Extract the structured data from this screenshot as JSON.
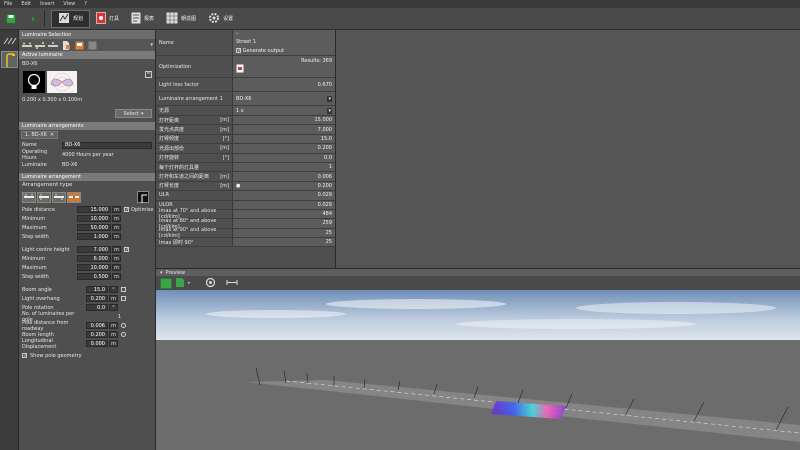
{
  "menu": [
    "File",
    "Edit",
    "Insert",
    "View",
    "?"
  ],
  "tabs": [
    {
      "label": "规划",
      "icon": "planning-icon",
      "active": true
    },
    {
      "label": "灯具",
      "icon": "luminaire-icon",
      "active": false
    },
    {
      "label": "报表",
      "icon": "report-icon",
      "active": false
    },
    {
      "label": "朝造图",
      "icon": "grid-icon",
      "active": false
    },
    {
      "label": "设置",
      "icon": "gear-icon",
      "active": false
    }
  ],
  "luminaire_selection": {
    "title": "Luminaire Selection",
    "active_section": "Active luminaire",
    "luminaire_name": "BD-X6",
    "dimensions": "0.200 x 0.300 x 0.100m",
    "select_button": "Select"
  },
  "arrangements": {
    "section": "Luminaire arrangements",
    "tab_label": "1. BD-X6",
    "rows": [
      {
        "label": "Name",
        "value": "BD-X6"
      },
      {
        "label": "Operating Hours",
        "value": "4000 Hours per year"
      },
      {
        "label": "Luminaire",
        "value": "BD-X6"
      }
    ]
  },
  "arrangement": {
    "section": "Luminaire arrangement",
    "type_label": "Arrangement type",
    "pole_distance": {
      "label": "Pole distance",
      "value": "15.000",
      "unit": "m",
      "optimise": "Optimise"
    },
    "pole_fields": [
      {
        "label": "Minimum",
        "value": "10.000",
        "unit": "m"
      },
      {
        "label": "Maximum",
        "value": "50.000",
        "unit": "m"
      },
      {
        "label": "Step width",
        "value": "1.000",
        "unit": "m"
      }
    ],
    "light_centre": {
      "label": "Light centre height",
      "value": "7.000",
      "unit": "m"
    },
    "light_fields": [
      {
        "label": "Minimum",
        "value": "6.000",
        "unit": "m"
      },
      {
        "label": "Maximum",
        "value": "10.000",
        "unit": "m"
      },
      {
        "label": "Step width",
        "value": "0.500",
        "unit": "m"
      }
    ],
    "boom_angle": {
      "label": "Boom angle",
      "value": "15.0",
      "unit": "°"
    },
    "light_overhang": {
      "label": "Light overhang",
      "value": "0.200",
      "unit": "m"
    },
    "pole_rotation": {
      "label": "Pole rotation",
      "value": "0.0",
      "unit": "°"
    },
    "num_luminaires": {
      "label": "No. of luminaires per pole",
      "value": "1"
    },
    "pole_dist_roadway": {
      "label": "Pole distance from roadway",
      "value": "0.006",
      "unit": "m"
    },
    "boom_length": {
      "label": "Boom length",
      "value": "0.200",
      "unit": "m"
    },
    "longitudinal": {
      "label": "Longitudinal Displacement",
      "value": "0.000",
      "unit": "m"
    },
    "show_pole": "Show pole geometry"
  },
  "properties": {
    "name": {
      "label": "Name",
      "value": "Street 1"
    },
    "generate_output": "Generate output",
    "optimization": {
      "label": "Optimization",
      "results": "Results: 369"
    },
    "llf": {
      "label": "Light loss factor",
      "value": "0.670"
    },
    "arr1": {
      "label": "Luminaire arrangement 1",
      "value": "BD-X6"
    },
    "dropdown2": {
      "label": "无源",
      "value": "1 x"
    },
    "rows": [
      {
        "label": "灯杆距离",
        "unit": "[m]",
        "value": "15.000"
      },
      {
        "label": "发光点高度",
        "unit": "[m]",
        "value": "7.000"
      },
      {
        "label": "灯臂倾度",
        "unit": "[°]",
        "value": "15.0"
      },
      {
        "label": "光源出部份",
        "unit": "[m]",
        "value": "0.200"
      },
      {
        "label": "灯杆旋转",
        "unit": "[°]",
        "value": "0.0"
      },
      {
        "label": "每个灯杆的灯具量",
        "unit": "",
        "value": "1"
      },
      {
        "label": "灯杆和车道之间的距离",
        "unit": "[m]",
        "value": "0.006"
      },
      {
        "label": "灯臂长度",
        "unit": "[m]",
        "value": "0.200"
      },
      {
        "label": "ULR",
        "unit": "",
        "value": "0.029"
      },
      {
        "label": "ULOR",
        "unit": "",
        "value": "0.029"
      },
      {
        "label": "Imax at 70° and above [cd/klm]",
        "unit": "",
        "value": "484"
      },
      {
        "label": "Imax at 80° and above [cd/klm]",
        "unit": "",
        "value": "259"
      },
      {
        "label": "Imax at 90° and above [cd/klm]",
        "unit": "",
        "value": "25"
      },
      {
        "label": "Imax 即时 90°",
        "unit": "",
        "value": "25"
      }
    ]
  },
  "preview": {
    "title": "Preview"
  },
  "colors": {
    "sky_top": "#6f8fb8",
    "sky_bottom": "#dfe6ee",
    "ground": "#6c6c6c",
    "road": "#858585",
    "panel": "#4f4f4f",
    "header": "#7a7a7a"
  }
}
